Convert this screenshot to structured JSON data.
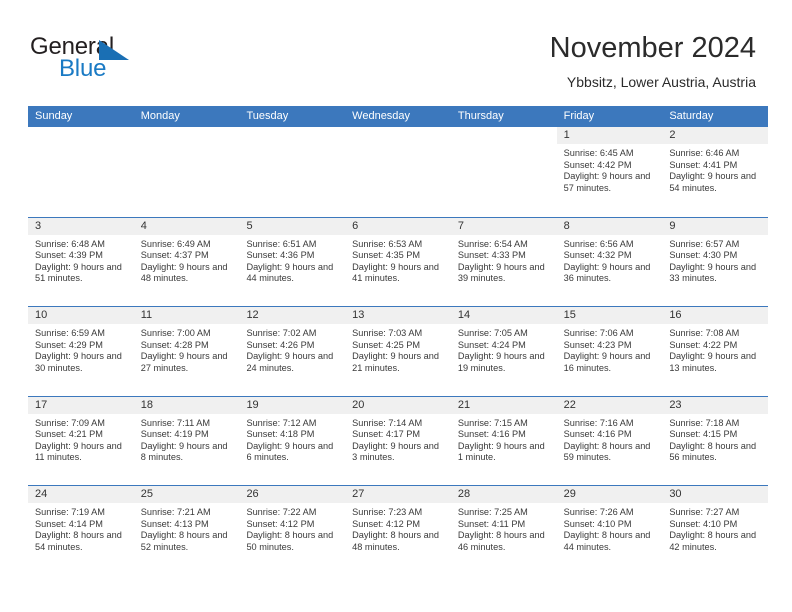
{
  "brand": {
    "name_top": "General",
    "name_bottom": "Blue",
    "triangle_icon": "triangle-icon",
    "color_dark": "#231f20",
    "color_blue": "#1a7ac4"
  },
  "header": {
    "title": "November 2024",
    "subtitle": "Ybbsitz, Lower Austria, Austria"
  },
  "theme": {
    "header_blue": "#3c78bd",
    "daynum_band": "#f0f0f0",
    "text": "#3a3a3a"
  },
  "calendar": {
    "weekdays": [
      "Sunday",
      "Monday",
      "Tuesday",
      "Wednesday",
      "Thursday",
      "Friday",
      "Saturday"
    ],
    "weeks": [
      [
        {
          "day": "",
          "empty": true
        },
        {
          "day": "",
          "empty": true
        },
        {
          "day": "",
          "empty": true
        },
        {
          "day": "",
          "empty": true
        },
        {
          "day": "",
          "empty": true
        },
        {
          "day": "1",
          "sunrise": "Sunrise: 6:45 AM",
          "sunset": "Sunset: 4:42 PM",
          "daylight": "Daylight: 9 hours and 57 minutes."
        },
        {
          "day": "2",
          "sunrise": "Sunrise: 6:46 AM",
          "sunset": "Sunset: 4:41 PM",
          "daylight": "Daylight: 9 hours and 54 minutes."
        }
      ],
      [
        {
          "day": "3",
          "sunrise": "Sunrise: 6:48 AM",
          "sunset": "Sunset: 4:39 PM",
          "daylight": "Daylight: 9 hours and 51 minutes."
        },
        {
          "day": "4",
          "sunrise": "Sunrise: 6:49 AM",
          "sunset": "Sunset: 4:37 PM",
          "daylight": "Daylight: 9 hours and 48 minutes."
        },
        {
          "day": "5",
          "sunrise": "Sunrise: 6:51 AM",
          "sunset": "Sunset: 4:36 PM",
          "daylight": "Daylight: 9 hours and 44 minutes."
        },
        {
          "day": "6",
          "sunrise": "Sunrise: 6:53 AM",
          "sunset": "Sunset: 4:35 PM",
          "daylight": "Daylight: 9 hours and 41 minutes."
        },
        {
          "day": "7",
          "sunrise": "Sunrise: 6:54 AM",
          "sunset": "Sunset: 4:33 PM",
          "daylight": "Daylight: 9 hours and 39 minutes."
        },
        {
          "day": "8",
          "sunrise": "Sunrise: 6:56 AM",
          "sunset": "Sunset: 4:32 PM",
          "daylight": "Daylight: 9 hours and 36 minutes."
        },
        {
          "day": "9",
          "sunrise": "Sunrise: 6:57 AM",
          "sunset": "Sunset: 4:30 PM",
          "daylight": "Daylight: 9 hours and 33 minutes."
        }
      ],
      [
        {
          "day": "10",
          "sunrise": "Sunrise: 6:59 AM",
          "sunset": "Sunset: 4:29 PM",
          "daylight": "Daylight: 9 hours and 30 minutes."
        },
        {
          "day": "11",
          "sunrise": "Sunrise: 7:00 AM",
          "sunset": "Sunset: 4:28 PM",
          "daylight": "Daylight: 9 hours and 27 minutes."
        },
        {
          "day": "12",
          "sunrise": "Sunrise: 7:02 AM",
          "sunset": "Sunset: 4:26 PM",
          "daylight": "Daylight: 9 hours and 24 minutes."
        },
        {
          "day": "13",
          "sunrise": "Sunrise: 7:03 AM",
          "sunset": "Sunset: 4:25 PM",
          "daylight": "Daylight: 9 hours and 21 minutes."
        },
        {
          "day": "14",
          "sunrise": "Sunrise: 7:05 AM",
          "sunset": "Sunset: 4:24 PM",
          "daylight": "Daylight: 9 hours and 19 minutes."
        },
        {
          "day": "15",
          "sunrise": "Sunrise: 7:06 AM",
          "sunset": "Sunset: 4:23 PM",
          "daylight": "Daylight: 9 hours and 16 minutes."
        },
        {
          "day": "16",
          "sunrise": "Sunrise: 7:08 AM",
          "sunset": "Sunset: 4:22 PM",
          "daylight": "Daylight: 9 hours and 13 minutes."
        }
      ],
      [
        {
          "day": "17",
          "sunrise": "Sunrise: 7:09 AM",
          "sunset": "Sunset: 4:21 PM",
          "daylight": "Daylight: 9 hours and 11 minutes."
        },
        {
          "day": "18",
          "sunrise": "Sunrise: 7:11 AM",
          "sunset": "Sunset: 4:19 PM",
          "daylight": "Daylight: 9 hours and 8 minutes."
        },
        {
          "day": "19",
          "sunrise": "Sunrise: 7:12 AM",
          "sunset": "Sunset: 4:18 PM",
          "daylight": "Daylight: 9 hours and 6 minutes."
        },
        {
          "day": "20",
          "sunrise": "Sunrise: 7:14 AM",
          "sunset": "Sunset: 4:17 PM",
          "daylight": "Daylight: 9 hours and 3 minutes."
        },
        {
          "day": "21",
          "sunrise": "Sunrise: 7:15 AM",
          "sunset": "Sunset: 4:16 PM",
          "daylight": "Daylight: 9 hours and 1 minute."
        },
        {
          "day": "22",
          "sunrise": "Sunrise: 7:16 AM",
          "sunset": "Sunset: 4:16 PM",
          "daylight": "Daylight: 8 hours and 59 minutes."
        },
        {
          "day": "23",
          "sunrise": "Sunrise: 7:18 AM",
          "sunset": "Sunset: 4:15 PM",
          "daylight": "Daylight: 8 hours and 56 minutes."
        }
      ],
      [
        {
          "day": "24",
          "sunrise": "Sunrise: 7:19 AM",
          "sunset": "Sunset: 4:14 PM",
          "daylight": "Daylight: 8 hours and 54 minutes."
        },
        {
          "day": "25",
          "sunrise": "Sunrise: 7:21 AM",
          "sunset": "Sunset: 4:13 PM",
          "daylight": "Daylight: 8 hours and 52 minutes."
        },
        {
          "day": "26",
          "sunrise": "Sunrise: 7:22 AM",
          "sunset": "Sunset: 4:12 PM",
          "daylight": "Daylight: 8 hours and 50 minutes."
        },
        {
          "day": "27",
          "sunrise": "Sunrise: 7:23 AM",
          "sunset": "Sunset: 4:12 PM",
          "daylight": "Daylight: 8 hours and 48 minutes."
        },
        {
          "day": "28",
          "sunrise": "Sunrise: 7:25 AM",
          "sunset": "Sunset: 4:11 PM",
          "daylight": "Daylight: 8 hours and 46 minutes."
        },
        {
          "day": "29",
          "sunrise": "Sunrise: 7:26 AM",
          "sunset": "Sunset: 4:10 PM",
          "daylight": "Daylight: 8 hours and 44 minutes."
        },
        {
          "day": "30",
          "sunrise": "Sunrise: 7:27 AM",
          "sunset": "Sunset: 4:10 PM",
          "daylight": "Daylight: 8 hours and 42 minutes."
        }
      ]
    ]
  }
}
